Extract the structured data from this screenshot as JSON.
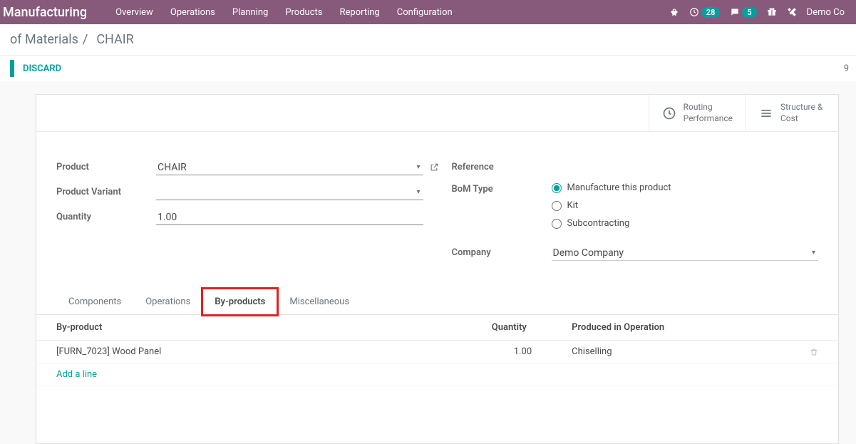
{
  "colors": {
    "primary": "#875A7B",
    "teal": "#00A09D"
  },
  "navbar": {
    "brand": "Manufacturing",
    "menu": [
      "Overview",
      "Operations",
      "Planning",
      "Products",
      "Reporting",
      "Configuration"
    ],
    "activity_count": "28",
    "chat_count": "5",
    "user": "Demo Co"
  },
  "breadcrumb": {
    "parent": "of Materials",
    "sep": "/",
    "current": "CHAIR"
  },
  "actions": {
    "discard": "DISCARD",
    "counter": "9"
  },
  "statbtns": {
    "routing": {
      "l1": "Routing",
      "l2": "Performance"
    },
    "structure": {
      "l1": "Structure &",
      "l2": "Cost"
    }
  },
  "form": {
    "product_label": "Product",
    "product_value": "CHAIR",
    "variant_label": "Product Variant",
    "variant_value": "",
    "quantity_label": "Quantity",
    "quantity_value": "1.00",
    "reference_label": "Reference",
    "bom_type_label": "BoM Type",
    "bom_options": {
      "manufacture": "Manufacture this product",
      "kit": "Kit",
      "subcontract": "Subcontracting"
    },
    "company_label": "Company",
    "company_value": "Demo Company"
  },
  "tabs": {
    "components": "Components",
    "operations": "Operations",
    "byproducts": "By-products",
    "misc": "Miscellaneous"
  },
  "table": {
    "col_byproduct": "By-product",
    "col_qty": "Quantity",
    "col_op": "Produced in Operation",
    "rows": [
      {
        "product": "[FURN_7023] Wood Panel",
        "qty": "1.00",
        "op": "Chiselling"
      }
    ],
    "addline": "Add a line"
  }
}
